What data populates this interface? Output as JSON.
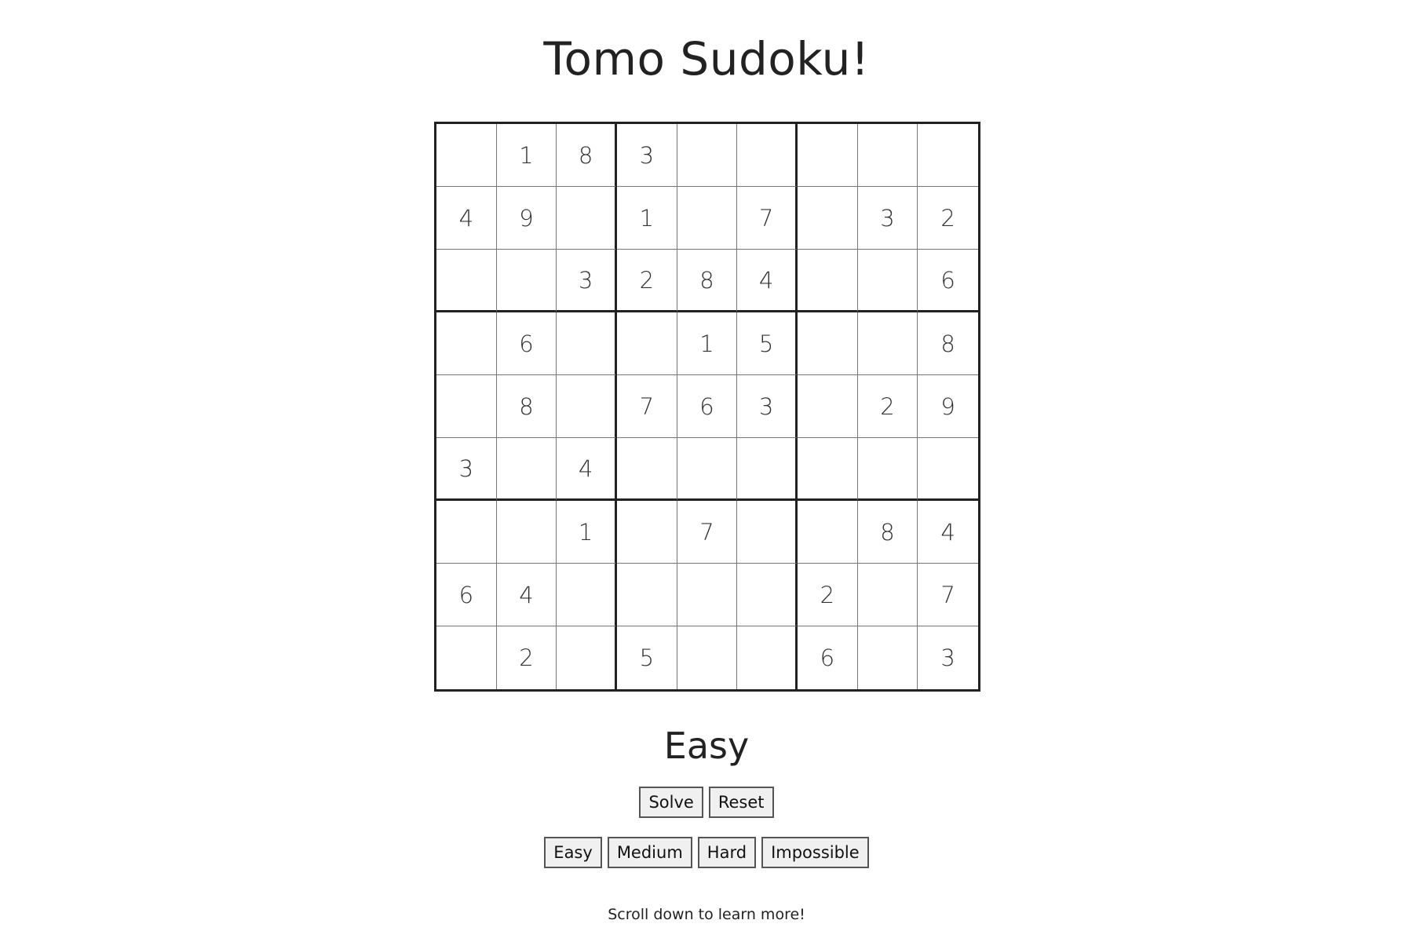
{
  "title": "Tomo Sudoku!",
  "board": [
    [
      "",
      "1",
      "8",
      "3",
      "",
      "",
      "",
      "",
      ""
    ],
    [
      "4",
      "9",
      "",
      "1",
      "",
      "7",
      "",
      "3",
      "2"
    ],
    [
      "",
      "",
      "3",
      "2",
      "8",
      "4",
      "",
      "",
      "6"
    ],
    [
      "",
      "6",
      "",
      "",
      "1",
      "5",
      "",
      "",
      "8"
    ],
    [
      "",
      "8",
      "",
      "7",
      "6",
      "3",
      "",
      "2",
      "9"
    ],
    [
      "3",
      "",
      "4",
      "",
      "",
      "",
      "",
      "",
      ""
    ],
    [
      "",
      "",
      "1",
      "",
      "7",
      "",
      "",
      "8",
      "4"
    ],
    [
      "6",
      "4",
      "",
      "",
      "",
      "",
      "2",
      "",
      "7"
    ],
    [
      "",
      "2",
      "",
      "5",
      "",
      "",
      "6",
      "",
      "3"
    ]
  ],
  "difficulty": "Easy",
  "actions": {
    "solve_label": "Solve",
    "reset_label": "Reset"
  },
  "levels": {
    "easy_label": "Easy",
    "medium_label": "Medium",
    "hard_label": "Hard",
    "impossible_label": "Impossible"
  },
  "hint": "Scroll down to learn more!"
}
